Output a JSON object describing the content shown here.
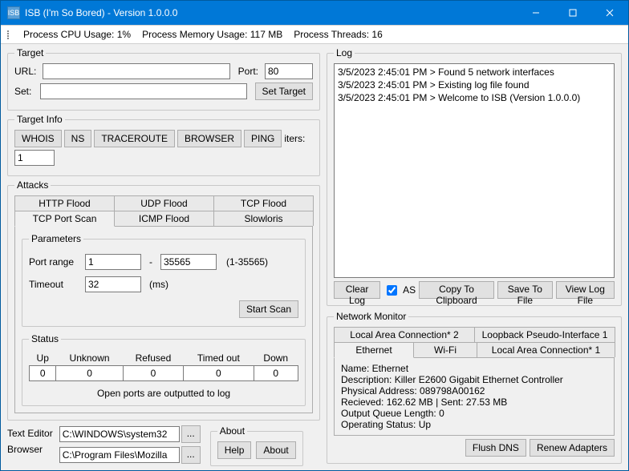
{
  "window": {
    "title": "ISB (I'm So Bored) - Version 1.0.0.0",
    "icon_text": "ISB"
  },
  "status": {
    "cpu_label": "Process CPU Usage: 1%",
    "mem_label": "Process Memory Usage: 117 MB",
    "threads_label": "Process Threads: 16"
  },
  "target": {
    "legend": "Target",
    "url_label": "URL:",
    "url_value": "",
    "port_label": "Port:",
    "port_value": "80",
    "set_label": "Set:",
    "set_value": "",
    "set_target_btn": "Set Target"
  },
  "target_info": {
    "legend": "Target Info",
    "whois": "WHOIS",
    "ns": "NS",
    "traceroute": "TRACEROUTE",
    "browser": "BROWSER",
    "ping": "PING",
    "iters_label": "iters:",
    "iters_value": "1"
  },
  "attacks": {
    "legend": "Attacks",
    "tabs_row1": [
      "HTTP Flood",
      "UDP Flood",
      "TCP Flood"
    ],
    "tabs_row2": [
      "TCP Port Scan",
      "ICMP Flood",
      "Slowloris"
    ],
    "active_tab": "TCP Port Scan",
    "params": {
      "legend": "Parameters",
      "port_range_label": "Port range",
      "port_from": "1",
      "dash": "-",
      "port_to": "35565",
      "range_hint": "(1-35565)",
      "timeout_label": "Timeout",
      "timeout_value": "32",
      "timeout_unit": "(ms)",
      "start_btn": "Start Scan"
    },
    "status_group": {
      "legend": "Status",
      "headers": [
        "Up",
        "Unknown",
        "Refused",
        "Timed out",
        "Down"
      ],
      "values": [
        "0",
        "0",
        "0",
        "0",
        "0"
      ],
      "note": "Open ports are outputted to log"
    }
  },
  "paths": {
    "text_editor_label": "Text Editor",
    "text_editor_value": "C:\\WINDOWS\\system32",
    "browser_label": "Browser",
    "browser_value": "C:\\Program Files\\Mozilla",
    "browse_btn": "..."
  },
  "about": {
    "legend": "About",
    "help_btn": "Help",
    "about_btn": "About"
  },
  "log": {
    "legend": "Log",
    "lines": [
      "3/5/2023 2:45:01 PM > Found 5 network interfaces",
      "3/5/2023 2:45:01 PM > Existing log file found",
      "3/5/2023 2:45:01 PM > Welcome to ISB (Version 1.0.0.0)"
    ],
    "clear_btn": "Clear Log",
    "as_label": "AS",
    "as_checked": true,
    "copy_btn": "Copy To Clipboard",
    "save_btn": "Save To File",
    "view_btn": "View Log File"
  },
  "netmon": {
    "legend": "Network Monitor",
    "tabs_row1": [
      "Local Area Connection* 2",
      "Loopback Pseudo-Interface 1"
    ],
    "tabs_row2": [
      "Ethernet",
      "Wi-Fi",
      "Local Area Connection* 1"
    ],
    "active_tab": "Ethernet",
    "name": "Name: Ethernet",
    "desc": "Description: Killer E2600 Gigabit Ethernet Controller",
    "phys": "Physical Address: 089798A00162",
    "rxsx": "Recieved: 162.62 MB | Sent: 27.53 MB",
    "queue": "Output Queue Length: 0",
    "opstat": "Operating Status: Up",
    "flush_btn": "Flush DNS",
    "renew_btn": "Renew Adapters"
  }
}
